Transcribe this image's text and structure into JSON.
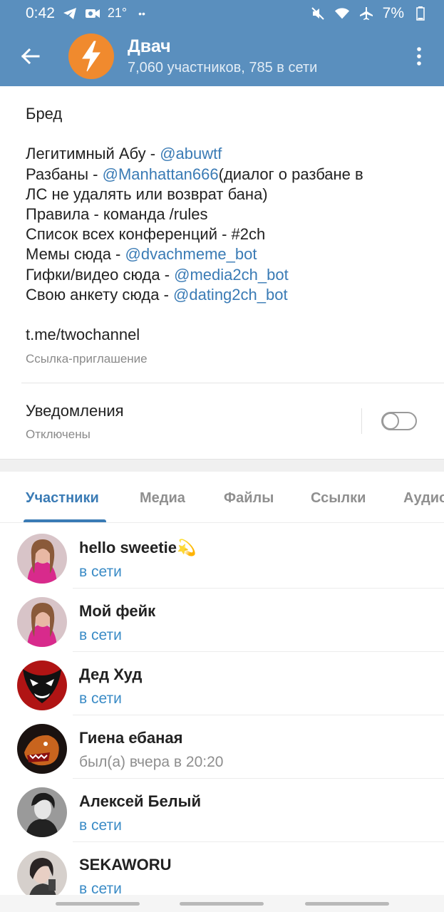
{
  "status_bar": {
    "time": "0:42",
    "temperature": "21°",
    "more": "••",
    "battery": "7%"
  },
  "header": {
    "title": "Двач",
    "subtitle": "7,060 участников, 785 в сети"
  },
  "description": [
    [
      {
        "t": "Бред"
      }
    ],
    [],
    [
      {
        "t": "Легитимный Абу - "
      },
      {
        "t": "@abuwtf",
        "link": true
      }
    ],
    [
      {
        "t": "Разбаны - "
      },
      {
        "t": "@Manhattan666",
        "link": true
      },
      {
        "t": "(диалог о разбане в"
      }
    ],
    [
      {
        "t": "ЛС не удалять или возврат бана)"
      }
    ],
    [
      {
        "t": "Правила - команда /rules"
      }
    ],
    [
      {
        "t": "Список всех конференций - #2ch"
      }
    ],
    [
      {
        "t": "Мемы сюда - "
      },
      {
        "t": "@dvachmeme_bot",
        "link": true
      }
    ],
    [
      {
        "t": "Гифки/видео сюда - "
      },
      {
        "t": "@media2ch_bot",
        "link": true
      }
    ],
    [
      {
        "t": "Свою анкету сюда - "
      },
      {
        "t": "@dating2ch_bot",
        "link": true
      }
    ]
  ],
  "invite": {
    "link": "t.me/twochannel",
    "label": "Ссылка-приглашение"
  },
  "notifications": {
    "label": "Уведомления",
    "status": "Отключены"
  },
  "tabs": [
    "Участники",
    "Медиа",
    "Файлы",
    "Ссылки",
    "Аудио"
  ],
  "members": [
    {
      "name": "hello sweetie",
      "emoji": "💫",
      "status": "в сети",
      "online": true
    },
    {
      "name": "Мой фейк",
      "status": "в сети",
      "online": true
    },
    {
      "name": "Дед Худ",
      "status": "в сети",
      "online": true
    },
    {
      "name": "Гиена ебаная",
      "status": "был(а) вчера в 20:20",
      "online": false
    },
    {
      "name": "Алексей Белый",
      "status": "в сети",
      "online": true
    },
    {
      "name": "SEKAWORU",
      "status": "в сети",
      "online": true
    }
  ],
  "colors": {
    "header": "#5a8fbe",
    "accent": "#3a7bb5",
    "online": "#3a8bc6",
    "channel_avatar": "#f08a2e"
  }
}
